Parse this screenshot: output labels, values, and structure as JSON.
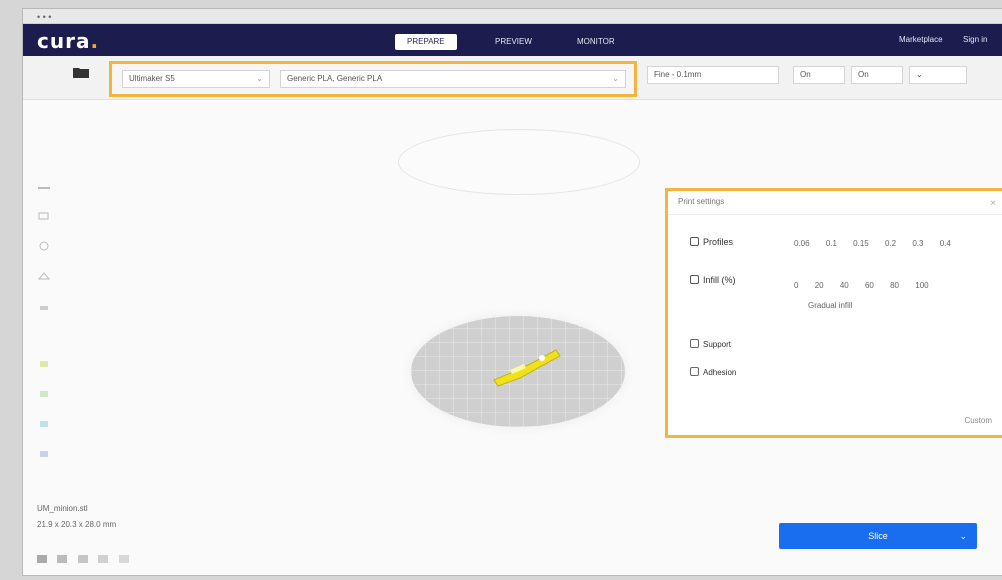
{
  "window": {
    "app_name": "",
    "title": ""
  },
  "navbar": {
    "brand": "cura",
    "tabs": [
      "PREPARE",
      "PREVIEW",
      "MONITOR"
    ],
    "right": [
      "Marketplace",
      "Sign in"
    ]
  },
  "toolbar": {
    "printer": "Ultimaker S5",
    "material": "Generic PLA, Generic PLA",
    "profile": "Fine - 0.1mm",
    "support": "On",
    "adhesion": "On"
  },
  "print_settings": {
    "header": "Print settings",
    "profiles_label": "Profiles",
    "profiles_values": [
      "0.06",
      "0.1",
      "0.15",
      "0.2",
      "0.3",
      "0.4"
    ],
    "infill_label": "Infill (%)",
    "infill_values": [
      "0",
      "20",
      "40",
      "60",
      "80",
      "100"
    ],
    "infill_sub": "Gradual infill",
    "support_label": "Support",
    "adhesion_label": "Adhesion",
    "custom_button": "Custom"
  },
  "left_panel": {
    "object_name": "UM_minion.stl",
    "dimensions": "21.9 x 20.3 x 28.0 mm"
  },
  "slice_button": {
    "label": "Slice"
  },
  "colors": {
    "navbar": "#1c1c4e",
    "accent_highlight": "#f3b53f",
    "primary_button": "#196ef0",
    "model": "#f0e21a"
  },
  "icons": {
    "sidebar_toggle": "folder-icon",
    "close": "close-icon",
    "chevron": "chevron-down-icon"
  }
}
